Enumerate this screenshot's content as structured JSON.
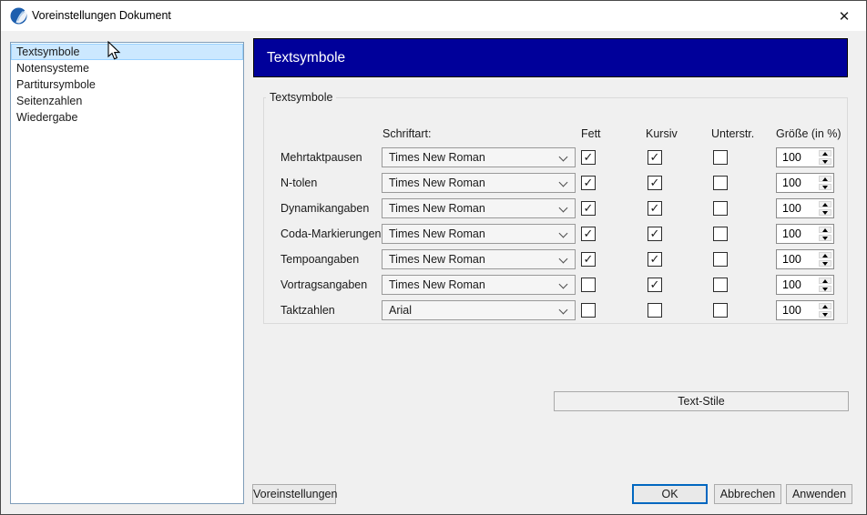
{
  "window": {
    "title": "Voreinstellungen Dokument"
  },
  "icons": {
    "app_icon": "forte-blue-sphere-logo",
    "close_glyph": "✕",
    "check_glyph": "✓",
    "chevron_down": "css-chevron",
    "spin_up": "black-triangle-up",
    "spin_down": "black-triangle-down",
    "cursor": "arrow-pointer"
  },
  "colors": {
    "header_bg": "#00009a",
    "header_text": "#ffffff",
    "selection_bg": "#cce8ff",
    "selection_border": "#99d1ff",
    "listbox_border": "#7f9db9",
    "ok_border": "#0067c0",
    "dialog_bg": "#f0f0f0"
  },
  "sidebar": {
    "items": [
      {
        "label": "Textsymbole",
        "selected": true
      },
      {
        "label": "Notensysteme",
        "selected": false
      },
      {
        "label": "Partitursymbole",
        "selected": false
      },
      {
        "label": "Seitenzahlen",
        "selected": false
      },
      {
        "label": "Wiedergabe",
        "selected": false
      }
    ]
  },
  "header": {
    "title": "Textsymbole"
  },
  "panel": {
    "group_title": "Textsymbole",
    "columns": {
      "font": "Schriftart:",
      "bold": "Fett",
      "italic": "Kursiv",
      "underline": "Unterstr.",
      "size": "Größe (in %)"
    },
    "rows": [
      {
        "label": "Mehrtaktpausen",
        "font": "Times New Roman",
        "bold": true,
        "italic": true,
        "underline": false,
        "size": "100"
      },
      {
        "label": "N-tolen",
        "font": "Times New Roman",
        "bold": true,
        "italic": true,
        "underline": false,
        "size": "100"
      },
      {
        "label": "Dynamikangaben",
        "font": "Times New Roman",
        "bold": true,
        "italic": true,
        "underline": false,
        "size": "100"
      },
      {
        "label": "Coda-Markierungen",
        "font": "Times New Roman",
        "bold": true,
        "italic": true,
        "underline": false,
        "size": "100"
      },
      {
        "label": "Tempoangaben",
        "font": "Times New Roman",
        "bold": true,
        "italic": true,
        "underline": false,
        "size": "100"
      },
      {
        "label": "Vortragsangaben",
        "font": "Times New Roman",
        "bold": false,
        "italic": true,
        "underline": false,
        "size": "100"
      },
      {
        "label": "Taktzahlen",
        "font": "Arial",
        "bold": false,
        "italic": false,
        "underline": false,
        "size": "100"
      }
    ],
    "text_styles_button": "Text-Stile"
  },
  "footer": {
    "presets_button": "Voreinstellungen",
    "ok_button": "OK",
    "cancel_button": "Abbrechen",
    "apply_button": "Anwenden"
  }
}
